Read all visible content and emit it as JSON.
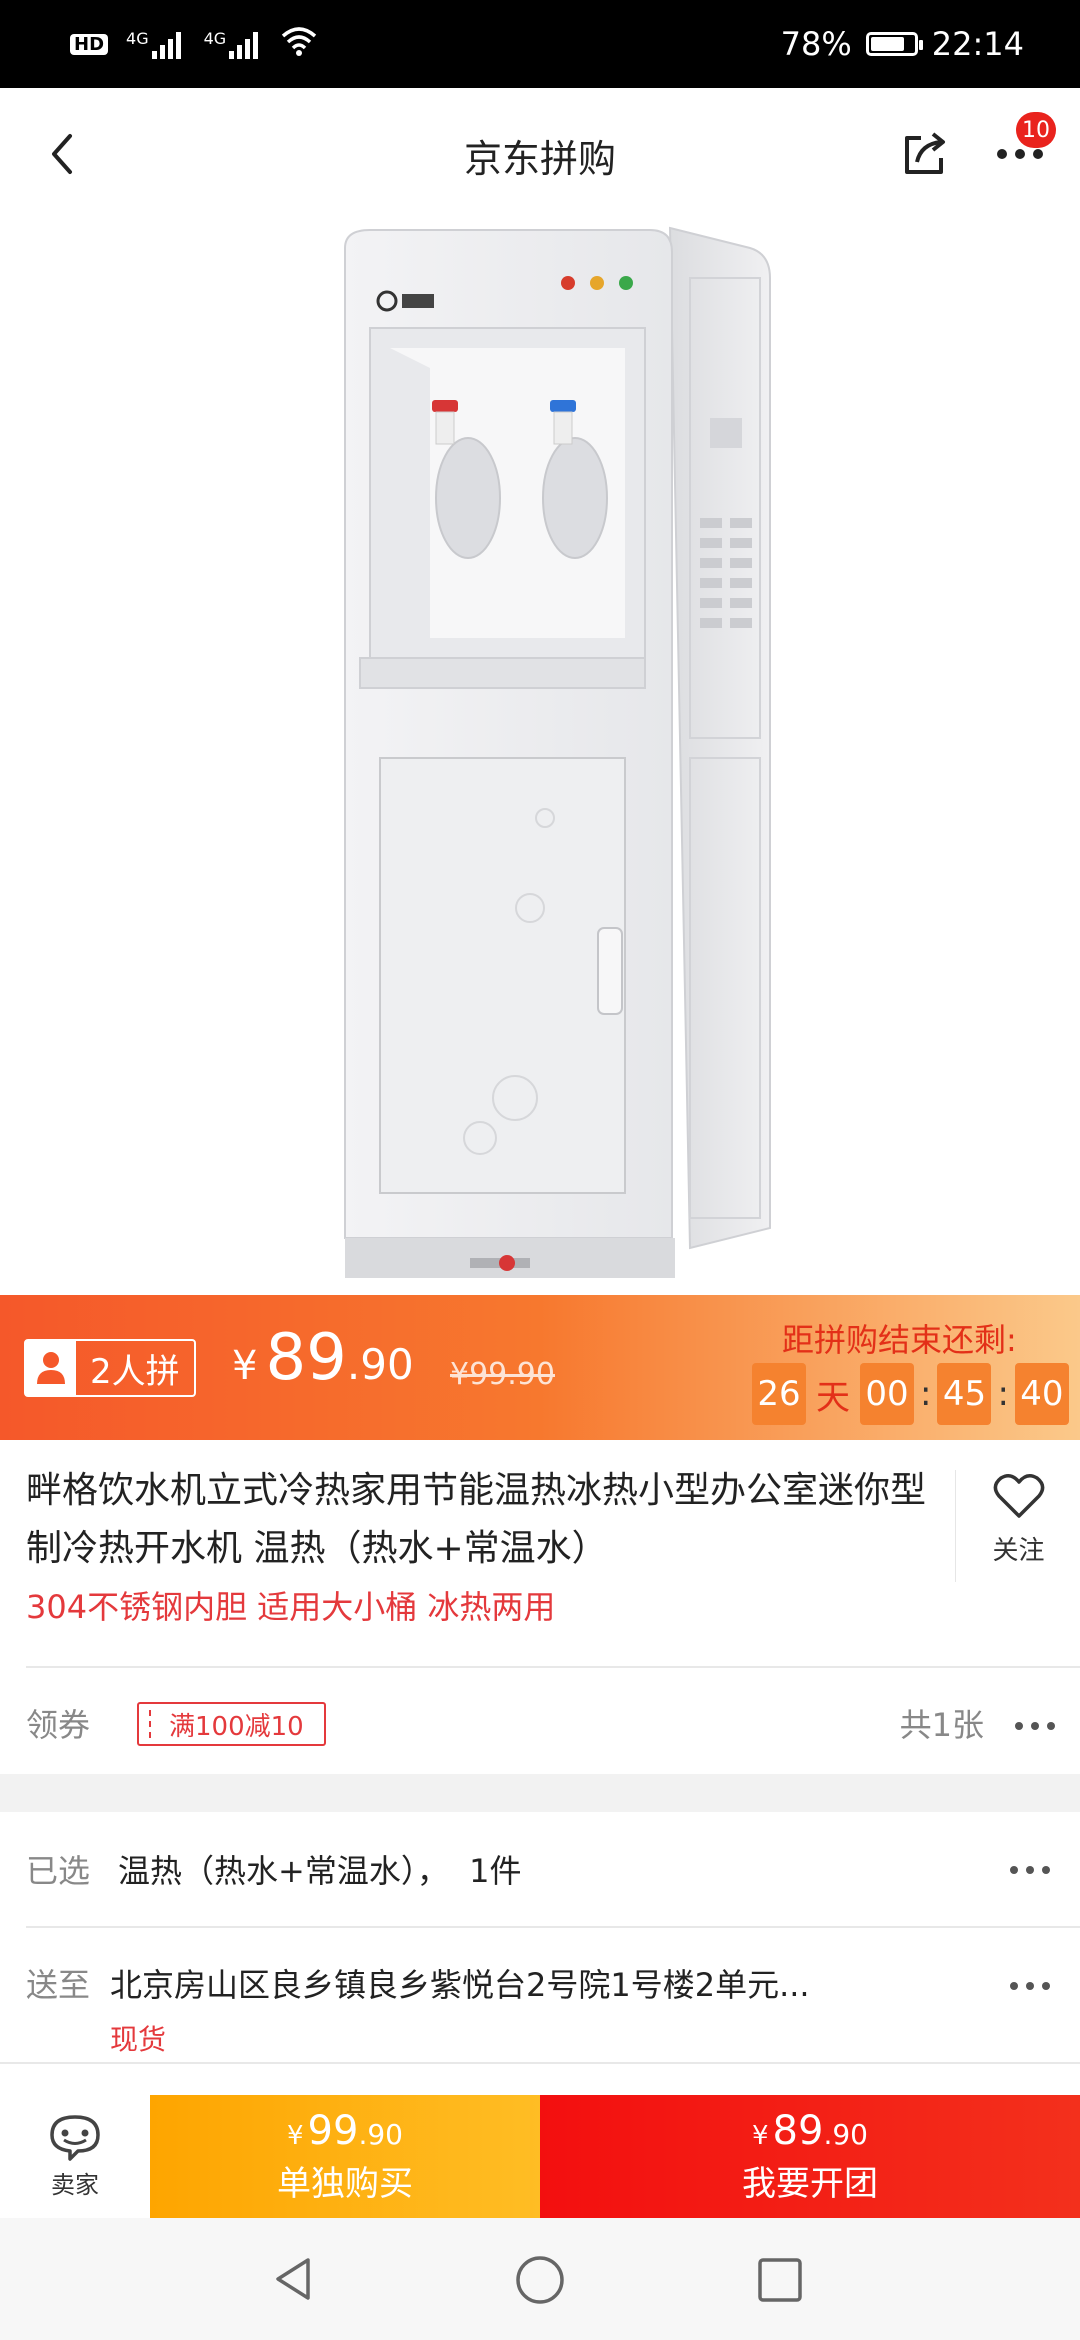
{
  "status_bar": {
    "left_icons": [
      "HD",
      "4G",
      "4G",
      "wifi-icon"
    ],
    "battery_percent": "78%",
    "battery_level": 0.78,
    "time": "22:14"
  },
  "header": {
    "title": "京东拼购",
    "badge_count": "10"
  },
  "price_banner": {
    "group_tag": "2人拼",
    "currency": "¥",
    "price_int": "89",
    "price_dec": ".90",
    "original_price": "¥99.90",
    "countdown_label": "距拼购结束还剩:",
    "days": "26",
    "days_unit": "天",
    "hours": "00",
    "minutes": "45",
    "seconds": "40",
    "sep": ":"
  },
  "product": {
    "title": "畔格饮水机立式冷热家用节能温热冰热小型办公室迷你型制冷热开水机 温热（热水+常温水）",
    "subtitle": "304不锈钢内胆 适用大小桶 冰热两用",
    "follow_label": "关注"
  },
  "coupon": {
    "label": "领券",
    "tag": "满100减10",
    "count": "共1张"
  },
  "selected": {
    "label": "已选",
    "value": "温热（热水+常温水），  1件"
  },
  "delivery": {
    "label": "送至",
    "address": "北京房山区良乡镇良乡紫悦台2号院1号楼2单元...",
    "stock": "现货"
  },
  "bottom_bar": {
    "seller_label": "卖家",
    "single_currency": "¥",
    "single_int": "99",
    "single_dec": ".90",
    "single_label": "单独购买",
    "group_currency": "¥",
    "group_int": "89",
    "group_dec": ".90",
    "group_label": "我要开团"
  },
  "colors": {
    "accent_red": "#e4393c",
    "banner_orange": "#f5582a",
    "buy_single": "#fea500",
    "buy_group": "#f30f0f"
  }
}
